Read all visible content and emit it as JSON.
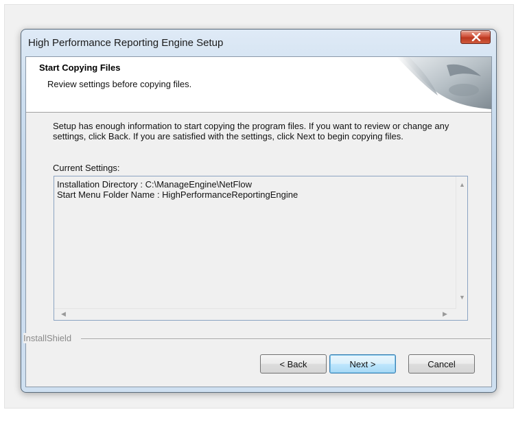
{
  "window": {
    "title": "High Performance Reporting Engine Setup",
    "close_icon": "close-x-icon"
  },
  "header": {
    "title": "Start Copying Files",
    "subtitle": "Review settings before copying files."
  },
  "description": "Setup has enough information to start copying the program files.  If you want to review or change any settings, click Back.  If you are satisfied with the settings, click Next to begin copying files.",
  "settings": {
    "label": "Current Settings:",
    "lines": [
      "Installation Directory : C:\\ManageEngine\\NetFlow",
      "Start Menu Folder Name : HighPerformanceReportingEngine"
    ]
  },
  "brand": "InstallShield",
  "buttons": {
    "back": "< Back",
    "next": "Next >",
    "cancel": "Cancel"
  },
  "colors": {
    "close_button": "#c9452d",
    "default_button_border": "#3c7fb1"
  }
}
